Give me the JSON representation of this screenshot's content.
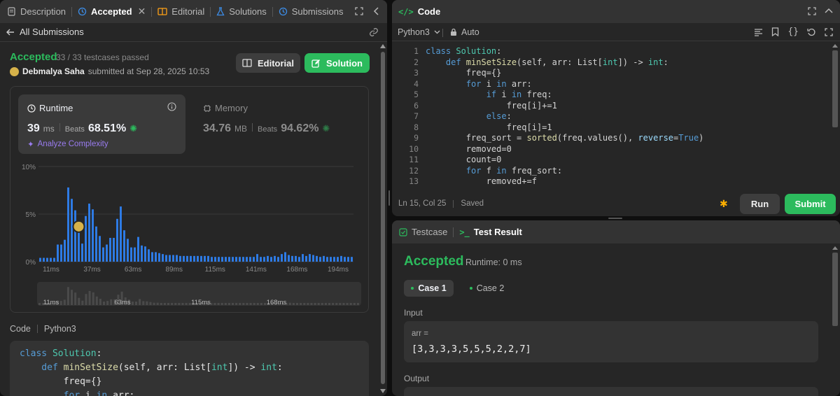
{
  "left_panel": {
    "tabs": [
      {
        "label": "Description",
        "icon": "document-icon",
        "color": "#c7c7c7"
      },
      {
        "label": "Accepted",
        "icon": "history-icon",
        "color": "#3c8de8"
      },
      {
        "label": "Editorial",
        "icon": "book-icon",
        "color": "#ffa116"
      },
      {
        "label": "Solutions",
        "icon": "flask-icon",
        "color": "#3c8de8"
      },
      {
        "label": "Submissions",
        "icon": "history-icon",
        "color": "#3c8de8"
      }
    ],
    "back_label": "All Submissions",
    "status": "Accepted",
    "testcases": "33 / 33 testcases passed",
    "author": "Debmalya Saha",
    "submitted_text": "submitted at Sep 28, 2025 10:53",
    "editorial_button": "Editorial",
    "solution_button": "Solution",
    "runtime": {
      "label": "Runtime",
      "value": "39",
      "unit": "ms",
      "beats_label": "Beats",
      "beats": "68.51%"
    },
    "memory": {
      "label": "Memory",
      "value": "34.76",
      "unit": "MB",
      "beats_label": "Beats",
      "beats": "94.62%"
    },
    "analyze_label": "Analyze Complexity",
    "code_header": "Code",
    "code_lang": "Python3"
  },
  "chart_data": {
    "type": "bar",
    "ylim": [
      0,
      10
    ],
    "y_ticks": [
      "10%",
      "5%",
      "0%"
    ],
    "x_ticks": [
      "11ms",
      "37ms",
      "63ms",
      "89ms",
      "115ms",
      "141ms",
      "168ms",
      "194ms"
    ],
    "values": [
      0.4,
      0.4,
      0.4,
      0.4,
      0.4,
      1.8,
      1.8,
      2.3,
      7.8,
      6.6,
      5.4,
      3.1,
      1.9,
      4.8,
      6.1,
      5.5,
      3.7,
      2.7,
      1.5,
      1.8,
      2.5,
      2.5,
      4.5,
      5.8,
      3.3,
      2.4,
      1.5,
      1.5,
      2.6,
      1.7,
      1.6,
      1.3,
      1.0,
      1.0,
      0.9,
      0.8,
      0.7,
      0.7,
      0.7,
      0.7,
      0.6,
      0.6,
      0.6,
      0.6,
      0.6,
      0.6,
      0.6,
      0.6,
      0.6,
      0.5,
      0.5,
      0.5,
      0.5,
      0.5,
      0.5,
      0.5,
      0.5,
      0.5,
      0.5,
      0.5,
      0.5,
      0.5,
      0.8,
      0.5,
      0.5,
      0.6,
      0.5,
      0.6,
      0.5,
      0.8,
      1.0,
      0.7,
      0.6,
      0.6,
      0.5,
      0.8,
      0.6,
      0.8,
      0.7,
      0.6,
      0.5,
      0.6,
      0.5,
      0.5,
      0.5,
      0.5,
      0.6,
      0.5,
      0.5,
      0.5
    ],
    "highlight_index": 11,
    "mini_ticks": [
      "11ms",
      "63ms",
      "115ms",
      "168ms"
    ],
    "bar_color": "#2e7de9"
  },
  "right_panel": {
    "code_title": "Code",
    "lang": "Python3",
    "mode": "Auto",
    "status": "Ln 15, Col 25",
    "saved": "Saved",
    "run": "Run",
    "submit": "Submit",
    "testcase_tab": "Testcase",
    "result_tab": "Test Result",
    "result_status": "Accepted",
    "result_runtime": "Runtime: 0 ms",
    "case1": "Case 1",
    "case2": "Case 2",
    "input_label": "Input",
    "input_var": "arr =",
    "input_value": "[3,3,3,3,5,5,5,2,2,7]",
    "output_label": "Output"
  },
  "editor_lines": [
    [
      [
        "class ",
        "kw"
      ],
      [
        "Solution",
        "cl"
      ],
      [
        ":",
        ""
      ]
    ],
    [
      [
        "    def ",
        "kw"
      ],
      [
        "minSetSize",
        "fn"
      ],
      [
        "(self, arr: List[",
        ""
      ],
      [
        "int",
        "ty"
      ],
      [
        "]) -> ",
        ""
      ],
      [
        "int",
        "ty"
      ],
      [
        ":",
        ""
      ]
    ],
    [
      [
        "        freq={}",
        ""
      ]
    ],
    [
      [
        "        for ",
        "kw"
      ],
      [
        "i ",
        ""
      ],
      [
        "in ",
        "kw"
      ],
      [
        "arr:",
        ""
      ]
    ],
    [
      [
        "            if ",
        "kw"
      ],
      [
        "i ",
        ""
      ],
      [
        "in ",
        "kw"
      ],
      [
        "freq:",
        ""
      ]
    ],
    [
      [
        "                freq[i]+=1",
        ""
      ]
    ],
    [
      [
        "            else",
        "kw"
      ],
      [
        ":",
        ""
      ]
    ],
    [
      [
        "                freq[i]=1",
        ""
      ]
    ],
    [
      [
        "        freq_sort = ",
        ""
      ],
      [
        "sorted",
        "fn"
      ],
      [
        "(freq.values(), ",
        ""
      ],
      [
        "reverse",
        "pr"
      ],
      [
        "=",
        ""
      ],
      [
        "True",
        "kw"
      ],
      [
        ")",
        ""
      ]
    ],
    [
      [
        "        removed=0",
        ""
      ]
    ],
    [
      [
        "        count=0",
        ""
      ]
    ],
    [
      [
        "        for ",
        "kw"
      ],
      [
        "f ",
        ""
      ],
      [
        "in ",
        "kw"
      ],
      [
        "freq_sort:",
        ""
      ]
    ],
    [
      [
        "            removed+=f",
        ""
      ]
    ]
  ],
  "bottom_code": [
    [
      [
        "class ",
        "kw"
      ],
      [
        "Solution",
        "cl"
      ],
      [
        ":",
        ""
      ]
    ],
    [
      [
        "    def ",
        "kw"
      ],
      [
        "minSetSize",
        "fn"
      ],
      [
        "(self, arr: List[",
        ""
      ],
      [
        "int",
        "ty"
      ],
      [
        "]) -> ",
        ""
      ],
      [
        "int",
        "ty"
      ],
      [
        ":",
        ""
      ]
    ],
    [
      [
        "        freq={}",
        ""
      ]
    ],
    [
      [
        "        for ",
        "kw"
      ],
      [
        "i ",
        ""
      ],
      [
        "in ",
        "kw"
      ],
      [
        "arr:",
        ""
      ]
    ]
  ]
}
